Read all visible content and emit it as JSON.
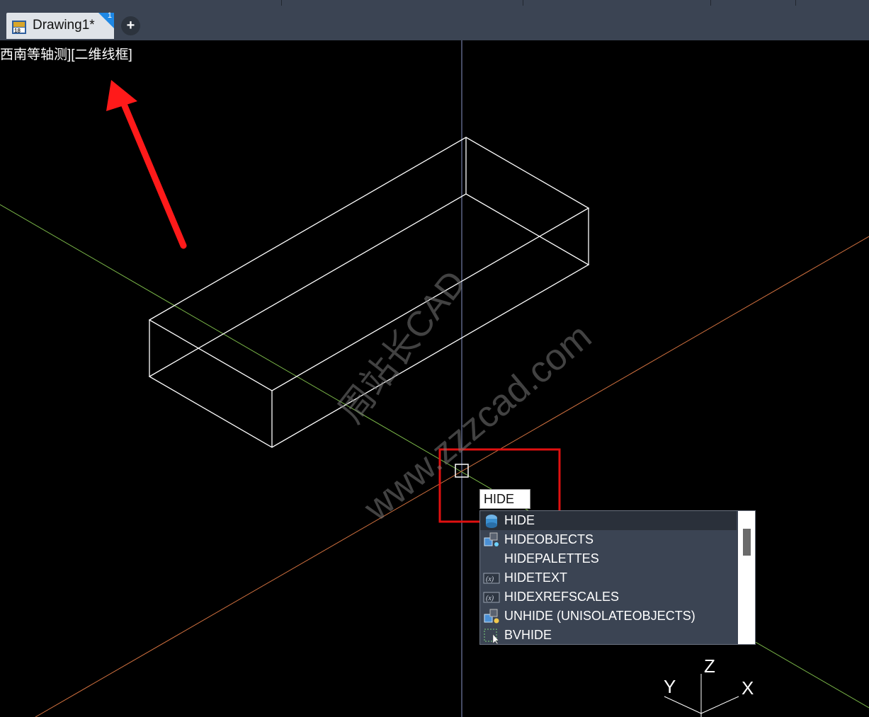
{
  "tab": {
    "title": "Drawing1*",
    "badge": "1",
    "new_tab_label": "+"
  },
  "viewport": {
    "view_label": "西南等轴测][二维线框]"
  },
  "watermark": {
    "line1": "周站长CAD",
    "line2": "www.zzzcad.com"
  },
  "command": {
    "input_value": "HIDE"
  },
  "autocomplete": {
    "items": [
      {
        "label": "HIDE",
        "icon": "hide-icon"
      },
      {
        "label": "HIDEOBJECTS",
        "icon": "hide-objects-icon"
      },
      {
        "label": "HIDEPALETTES",
        "icon": ""
      },
      {
        "label": "HIDETEXT",
        "icon": "system-variable-icon"
      },
      {
        "label": "HIDEXREFSCALES",
        "icon": "system-variable-icon"
      },
      {
        "label": "UNHIDE (UNISOLATEOBJECTS)",
        "icon": "unhide-icon"
      },
      {
        "label": "BVHIDE",
        "icon": "block-visibility-hide-icon"
      }
    ]
  },
  "ucs": {
    "x_label": "X",
    "y_label": "Y",
    "z_label": "Z"
  },
  "colors": {
    "background": "#000000",
    "panel": "#3b4453",
    "highlight_box": "#e01010",
    "axis_green": "#7ab648",
    "axis_red": "#d0703f",
    "axis_blue": "#8a96c8"
  }
}
